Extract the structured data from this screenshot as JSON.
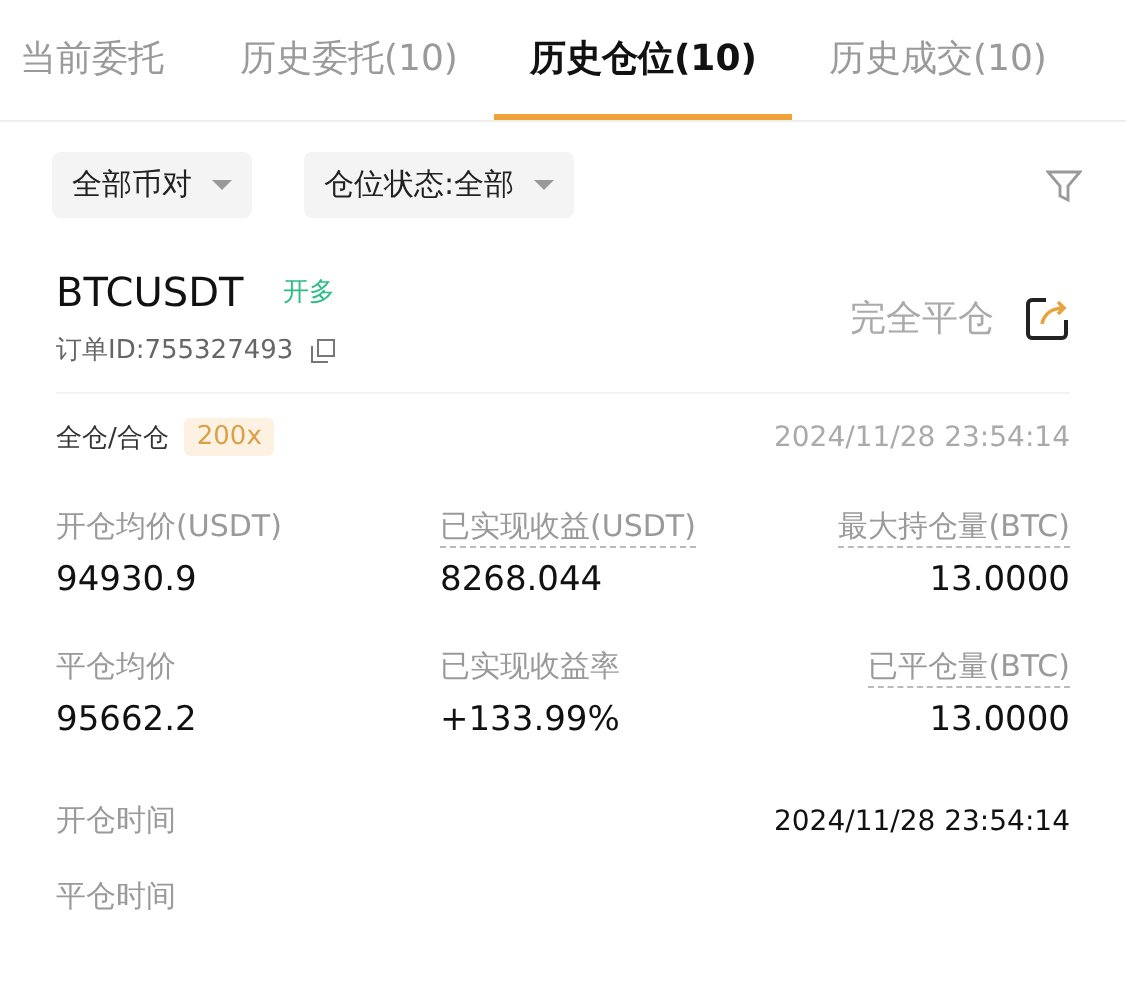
{
  "tabs": [
    {
      "label": "当前委托",
      "selected": false
    },
    {
      "label": "历史委托(10)",
      "selected": false
    },
    {
      "label": "历史仓位(10)",
      "selected": true
    },
    {
      "label": "历史成交(10)",
      "selected": false
    }
  ],
  "filters": [
    {
      "label": "全部币对"
    },
    {
      "label": "仓位状态:全部"
    }
  ],
  "position": {
    "symbol": "BTCUSDT",
    "side": {
      "label": "开多",
      "kind": "long"
    },
    "order_id": "订单ID:755327493",
    "status": "完全平仓",
    "margin_mode": "全仓/合仓",
    "leverage": "200x",
    "time": "2024/11/28 23:54:14",
    "stats": [
      {
        "label": "开仓均价(USDT)",
        "value": "94930.9",
        "dashed": false
      },
      {
        "label": "已实现收益(USDT)",
        "value": "8268.044",
        "dashed": true
      },
      {
        "label": "最大持仓量(BTC)",
        "value": "13.0000",
        "dashed": true
      },
      {
        "label": "平仓均价",
        "value": "95662.2",
        "dashed": false
      },
      {
        "label": "已实现收益率",
        "value": "+133.99%",
        "dashed": false
      },
      {
        "label": "已平仓量(BTC)",
        "value": "13.0000",
        "dashed": true
      }
    ],
    "times": [
      {
        "label": "开仓时间",
        "value": "2024/11/28 23:54:14"
      },
      {
        "label": "平仓时间"
      }
    ]
  }
}
